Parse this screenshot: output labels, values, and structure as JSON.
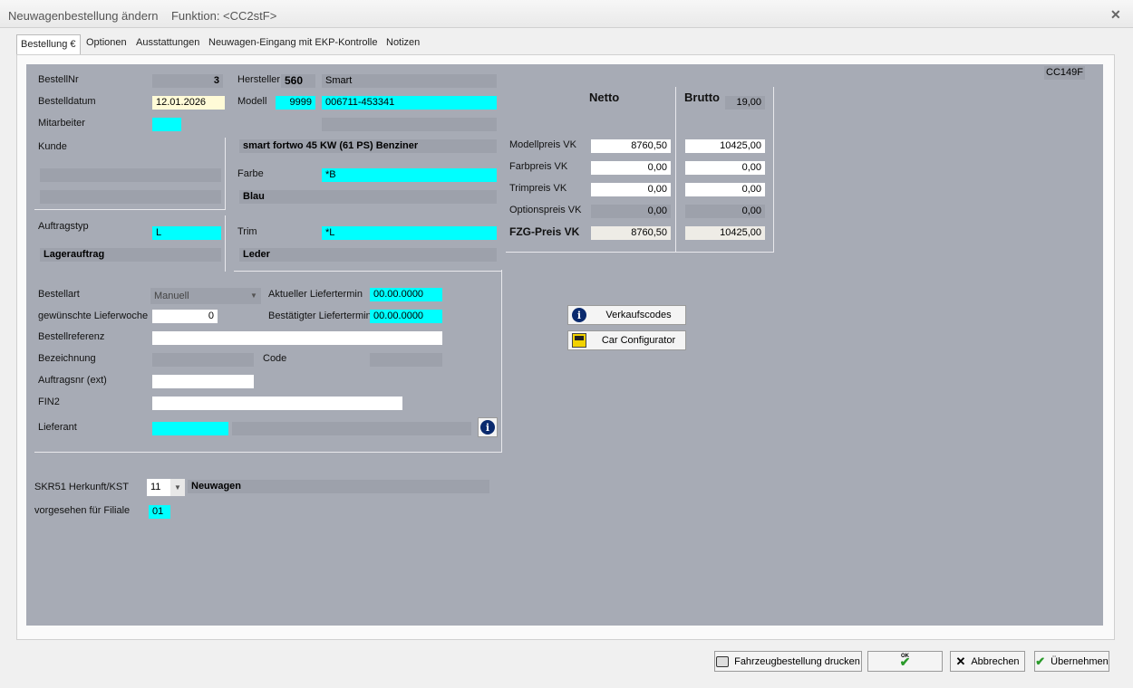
{
  "window": {
    "title": "Neuwagenbestellung ändern    Funktion: <CC2stF>"
  },
  "tabs": [
    "Bestellung €",
    "Optionen",
    "Ausstattungen",
    "Neuwagen-Eingang mit EKP-Kontrolle",
    "Notizen"
  ],
  "form_code": "CC149F",
  "order": {
    "bestellnr_label": "BestellNr",
    "bestellnr": "3",
    "bestelldatum_label": "Bestelldatum",
    "bestelldatum": "12.01.2026",
    "mitarbeiter_label": "Mitarbeiter",
    "kunde_label": "Kunde",
    "auftragstyp_label": "Auftragstyp",
    "auftragstyp": "L",
    "auftragstyp_text": "Lagerauftrag"
  },
  "vehicle": {
    "hersteller_label": "Hersteller",
    "hersteller_code": "560",
    "hersteller_name": "Smart",
    "modell_label": "Modell",
    "modell_code": "9999",
    "modell_nr": "006711-453341",
    "modell_text": "smart fortwo 45 KW (61 PS) Benziner",
    "farbe_label": "Farbe",
    "farbe_code": "*B",
    "farbe_text": "Blau",
    "trim_label": "Trim",
    "trim_code": "*L",
    "trim_text": "Leder"
  },
  "prices": {
    "netto_label": "Netto",
    "brutto_label": "Brutto",
    "vat": "19,00",
    "rows": [
      {
        "label": "Modellpreis VK",
        "netto": "8760,50",
        "brutto": "10425,00"
      },
      {
        "label": "Farbpreis VK",
        "netto": "0,00",
        "brutto": "0,00"
      },
      {
        "label": "Trimpreis VK",
        "netto": "0,00",
        "brutto": "0,00"
      },
      {
        "label": "Optionspreis VK",
        "netto": "0,00",
        "brutto": "0,00"
      },
      {
        "label": "FZG-Preis VK",
        "netto": "8760,50",
        "brutto": "10425,00"
      }
    ]
  },
  "details": {
    "bestellart_label": "Bestellart",
    "bestellart": "Manuell",
    "lieferwoche_label": "gewünschte Lieferwoche",
    "lieferwoche": "0",
    "akt_liefertermin_label": "Aktueller Liefertermin",
    "akt_liefertermin": "00.00.0000",
    "best_liefertermin_label": "Bestätigter Liefertermin",
    "best_liefertermin": "00.00.0000",
    "bestellreferenz_label": "Bestellreferenz",
    "bezeichnung_label": "Bezeichnung",
    "code_label": "Code",
    "auftragsnr_label": "Auftragsnr (ext)",
    "fin2_label": "FIN2",
    "lieferant_label": "Lieferant"
  },
  "side_buttons": {
    "verkaufscodes": "Verkaufscodes",
    "car_configurator": "Car Configurator"
  },
  "skr": {
    "herkunft_label": "SKR51 Herkunft/KST",
    "herkunft": "11",
    "herkunft_text": "Neuwagen",
    "filiale_label": "vorgesehen für Filiale",
    "filiale": "01"
  },
  "footer": {
    "print": "Fahrzeugbestellung drucken",
    "ok": "OK",
    "cancel": "Abbrechen",
    "apply": "Übernehmen"
  }
}
